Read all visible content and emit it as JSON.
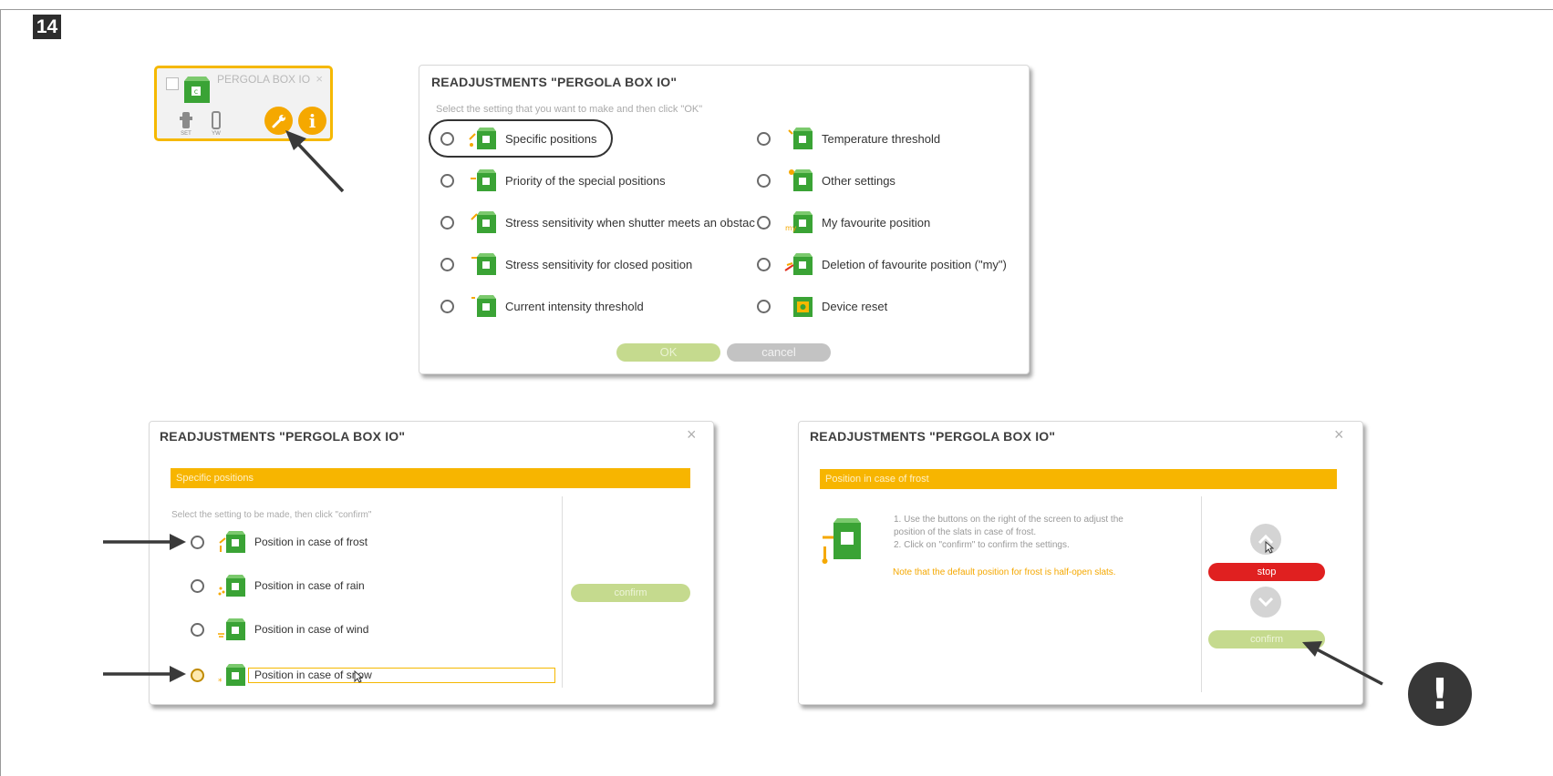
{
  "step_number": "14",
  "device_tile": {
    "name": "PERGOLA BOX IO",
    "set_label": "SET",
    "yw_label": "YW",
    "info_glyph": "i",
    "close_glyph": "×",
    "accent_color": "#f5b800"
  },
  "dialog_main": {
    "title": "READJUSTMENTS \"PERGOLA BOX IO\"",
    "hint": "Select the setting that you want to make and then click \"OK\"",
    "left_options": [
      {
        "label": "Specific positions"
      },
      {
        "label": "Priority of the special positions"
      },
      {
        "label": "Stress sensitivity when shutter meets an obstac"
      },
      {
        "label": "Stress sensitivity for closed position"
      },
      {
        "label": "Current intensity threshold"
      }
    ],
    "right_options": [
      {
        "label": "Temperature threshold"
      },
      {
        "label": "Other settings"
      },
      {
        "label": "My favourite position"
      },
      {
        "label": "Deletion of favourite position (\"my\")"
      },
      {
        "label": "Device reset"
      }
    ],
    "ok_label": "OK",
    "cancel_label": "cancel"
  },
  "dialog_positions": {
    "title": "READJUSTMENTS \"PERGOLA BOX IO\"",
    "close_glyph": "×",
    "section": "Specific positions",
    "hint": "Select the setting to be made, then click \"confirm\"",
    "options": [
      {
        "label": "Position in case of frost"
      },
      {
        "label": "Position in case of rain"
      },
      {
        "label": "Position in case of wind"
      },
      {
        "label": "Position in case of snow"
      }
    ],
    "confirm_label": "confirm"
  },
  "dialog_frost": {
    "title": "READJUSTMENTS \"PERGOLA BOX IO\"",
    "close_glyph": "×",
    "section": "Position in case of frost",
    "instruction_1": "1. Use the buttons on the right of the screen to adjust the",
    "instruction_1b": "position of the slats in case of frost.",
    "instruction_2": "2. Click on \"confirm\" to confirm the settings.",
    "note": "Note that the default position for frost is half-open slats.",
    "stop_label": "stop",
    "confirm_label": "confirm"
  },
  "warning_glyph": "!",
  "colors": {
    "accent_orange": "#f7b500",
    "device_green": "#3aa335",
    "confirm_green": "#c5da8e",
    "stop_red": "#e02020"
  }
}
